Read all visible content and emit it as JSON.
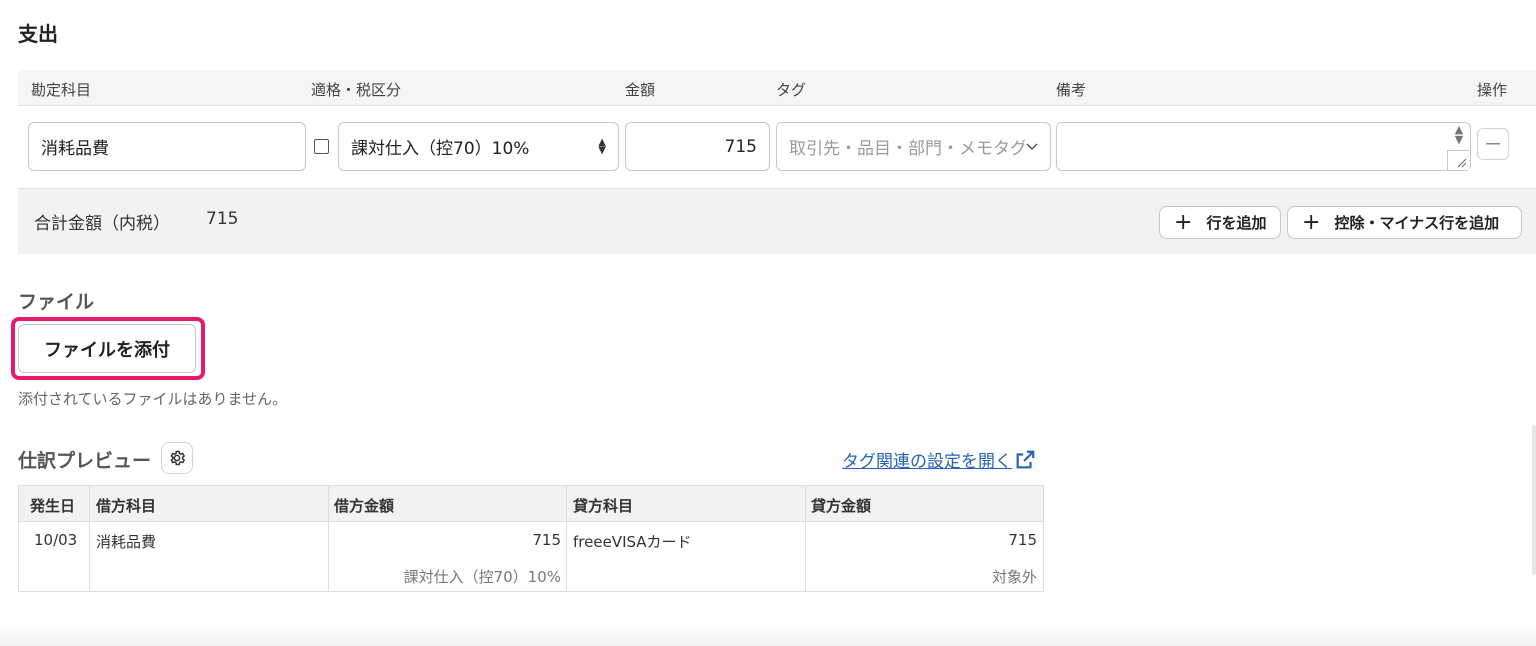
{
  "section": {
    "title": "支出"
  },
  "expense_table": {
    "headers": {
      "account": "勘定科目",
      "tax": "適格・税区分",
      "amount": "金額",
      "tag": "タグ",
      "note": "備考",
      "ops": "操作"
    },
    "row": {
      "account": "消耗品費",
      "tax_category": "課対仕入（控70）10%",
      "amount": "715",
      "tag_placeholder": "取引先・品目・部門・メモタグ",
      "note": ""
    },
    "total": {
      "label": "合計金額（内税）",
      "value": "715"
    },
    "buttons": {
      "add_row": "行を追加",
      "add_minus_row": "控除・マイナス行を追加"
    }
  },
  "file_section": {
    "title": "ファイル",
    "attach_button": "ファイルを添付",
    "empty_message": "添付されているファイルはありません。"
  },
  "preview": {
    "title": "仕訳プレビュー",
    "tag_settings_link": "タグ関連の設定を開く",
    "headers": [
      "発生日",
      "借方科目",
      "借方金額",
      "貸方科目",
      "貸方金額"
    ],
    "rows": [
      {
        "date": "10/03",
        "debit_account": "消耗品費",
        "debit_amount": "715",
        "debit_tax": "課対仕入（控70）10%",
        "credit_account": "freeeVISAカード",
        "credit_amount": "715",
        "credit_tax": "対象外"
      }
    ]
  },
  "colors": {
    "highlight": "#e8186b",
    "link": "#2864b4"
  }
}
